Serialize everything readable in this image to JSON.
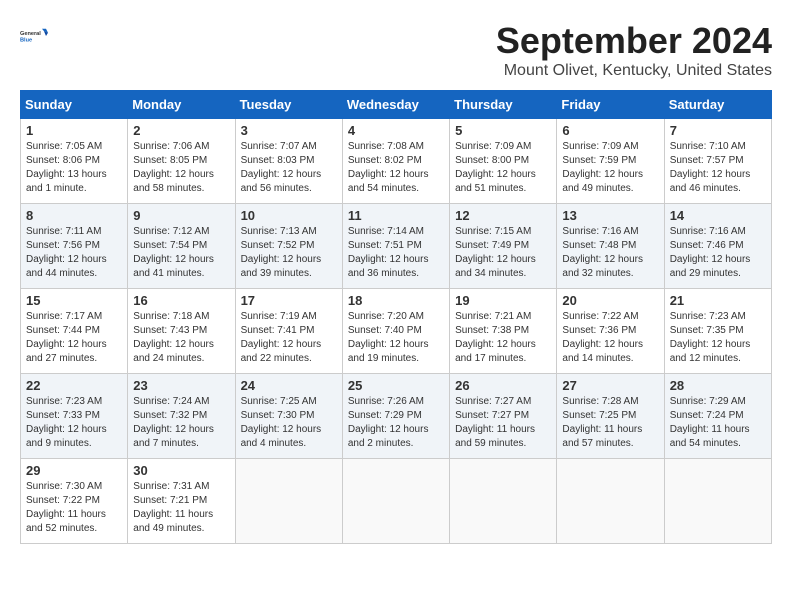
{
  "header": {
    "logo_general": "General",
    "logo_blue": "Blue",
    "month": "September 2024",
    "location": "Mount Olivet, Kentucky, United States"
  },
  "columns": [
    "Sunday",
    "Monday",
    "Tuesday",
    "Wednesday",
    "Thursday",
    "Friday",
    "Saturday"
  ],
  "weeks": [
    [
      {
        "day": "1",
        "info": "Sunrise: 7:05 AM\nSunset: 8:06 PM\nDaylight: 13 hours\nand 1 minute."
      },
      {
        "day": "2",
        "info": "Sunrise: 7:06 AM\nSunset: 8:05 PM\nDaylight: 12 hours\nand 58 minutes."
      },
      {
        "day": "3",
        "info": "Sunrise: 7:07 AM\nSunset: 8:03 PM\nDaylight: 12 hours\nand 56 minutes."
      },
      {
        "day": "4",
        "info": "Sunrise: 7:08 AM\nSunset: 8:02 PM\nDaylight: 12 hours\nand 54 minutes."
      },
      {
        "day": "5",
        "info": "Sunrise: 7:09 AM\nSunset: 8:00 PM\nDaylight: 12 hours\nand 51 minutes."
      },
      {
        "day": "6",
        "info": "Sunrise: 7:09 AM\nSunset: 7:59 PM\nDaylight: 12 hours\nand 49 minutes."
      },
      {
        "day": "7",
        "info": "Sunrise: 7:10 AM\nSunset: 7:57 PM\nDaylight: 12 hours\nand 46 minutes."
      }
    ],
    [
      {
        "day": "8",
        "info": "Sunrise: 7:11 AM\nSunset: 7:56 PM\nDaylight: 12 hours\nand 44 minutes."
      },
      {
        "day": "9",
        "info": "Sunrise: 7:12 AM\nSunset: 7:54 PM\nDaylight: 12 hours\nand 41 minutes."
      },
      {
        "day": "10",
        "info": "Sunrise: 7:13 AM\nSunset: 7:52 PM\nDaylight: 12 hours\nand 39 minutes."
      },
      {
        "day": "11",
        "info": "Sunrise: 7:14 AM\nSunset: 7:51 PM\nDaylight: 12 hours\nand 36 minutes."
      },
      {
        "day": "12",
        "info": "Sunrise: 7:15 AM\nSunset: 7:49 PM\nDaylight: 12 hours\nand 34 minutes."
      },
      {
        "day": "13",
        "info": "Sunrise: 7:16 AM\nSunset: 7:48 PM\nDaylight: 12 hours\nand 32 minutes."
      },
      {
        "day": "14",
        "info": "Sunrise: 7:16 AM\nSunset: 7:46 PM\nDaylight: 12 hours\nand 29 minutes."
      }
    ],
    [
      {
        "day": "15",
        "info": "Sunrise: 7:17 AM\nSunset: 7:44 PM\nDaylight: 12 hours\nand 27 minutes."
      },
      {
        "day": "16",
        "info": "Sunrise: 7:18 AM\nSunset: 7:43 PM\nDaylight: 12 hours\nand 24 minutes."
      },
      {
        "day": "17",
        "info": "Sunrise: 7:19 AM\nSunset: 7:41 PM\nDaylight: 12 hours\nand 22 minutes."
      },
      {
        "day": "18",
        "info": "Sunrise: 7:20 AM\nSunset: 7:40 PM\nDaylight: 12 hours\nand 19 minutes."
      },
      {
        "day": "19",
        "info": "Sunrise: 7:21 AM\nSunset: 7:38 PM\nDaylight: 12 hours\nand 17 minutes."
      },
      {
        "day": "20",
        "info": "Sunrise: 7:22 AM\nSunset: 7:36 PM\nDaylight: 12 hours\nand 14 minutes."
      },
      {
        "day": "21",
        "info": "Sunrise: 7:23 AM\nSunset: 7:35 PM\nDaylight: 12 hours\nand 12 minutes."
      }
    ],
    [
      {
        "day": "22",
        "info": "Sunrise: 7:23 AM\nSunset: 7:33 PM\nDaylight: 12 hours\nand 9 minutes."
      },
      {
        "day": "23",
        "info": "Sunrise: 7:24 AM\nSunset: 7:32 PM\nDaylight: 12 hours\nand 7 minutes."
      },
      {
        "day": "24",
        "info": "Sunrise: 7:25 AM\nSunset: 7:30 PM\nDaylight: 12 hours\nand 4 minutes."
      },
      {
        "day": "25",
        "info": "Sunrise: 7:26 AM\nSunset: 7:29 PM\nDaylight: 12 hours\nand 2 minutes."
      },
      {
        "day": "26",
        "info": "Sunrise: 7:27 AM\nSunset: 7:27 PM\nDaylight: 11 hours\nand 59 minutes."
      },
      {
        "day": "27",
        "info": "Sunrise: 7:28 AM\nSunset: 7:25 PM\nDaylight: 11 hours\nand 57 minutes."
      },
      {
        "day": "28",
        "info": "Sunrise: 7:29 AM\nSunset: 7:24 PM\nDaylight: 11 hours\nand 54 minutes."
      }
    ],
    [
      {
        "day": "29",
        "info": "Sunrise: 7:30 AM\nSunset: 7:22 PM\nDaylight: 11 hours\nand 52 minutes."
      },
      {
        "day": "30",
        "info": "Sunrise: 7:31 AM\nSunset: 7:21 PM\nDaylight: 11 hours\nand 49 minutes."
      },
      {
        "day": "",
        "info": ""
      },
      {
        "day": "",
        "info": ""
      },
      {
        "day": "",
        "info": ""
      },
      {
        "day": "",
        "info": ""
      },
      {
        "day": "",
        "info": ""
      }
    ]
  ]
}
